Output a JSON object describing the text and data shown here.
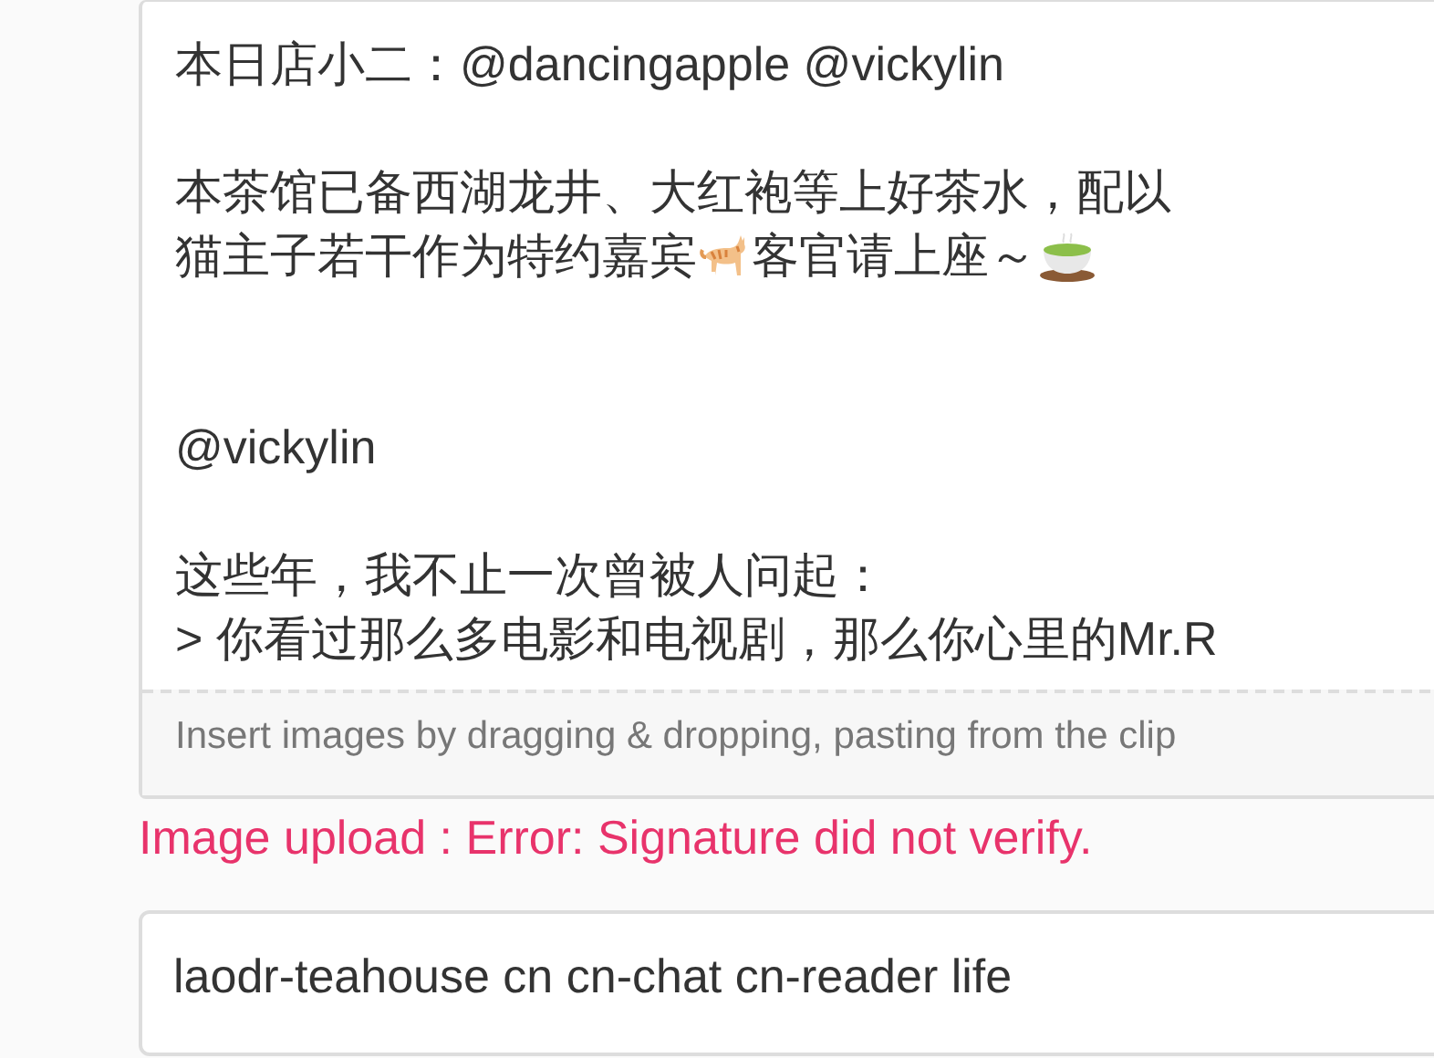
{
  "editor": {
    "sections": [
      {
        "lines": [
          {
            "text": "本日店小二：@dancingapple @vickylin"
          }
        ]
      },
      {
        "lines": [
          {
            "text": "本茶馆已备西湖龙井、大红袍等上好茶水，配以"
          },
          {
            "segments": [
              "猫主子若干作为特约嘉宾",
              "客官请上座～"
            ]
          }
        ]
      },
      {
        "lines": [
          {
            "text": "@vickylin"
          }
        ]
      },
      {
        "lines": [
          {
            "text": "这些年，我不止一次曾被人问起："
          },
          {
            "text": "> 你看过那么多电影和电视剧，那么你心里的Mr.R"
          }
        ]
      }
    ],
    "footer_hint": "Insert images by dragging & dropping, pasting from the clip"
  },
  "upload_error": "Image upload : Error: Signature did not verify.",
  "tags_field": {
    "value": "laodr-teahouse cn cn-chat cn-reader life"
  }
}
